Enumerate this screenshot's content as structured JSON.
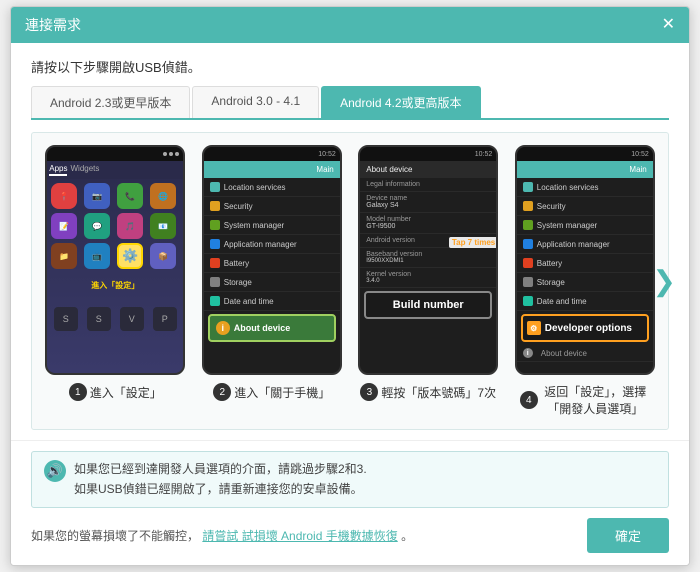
{
  "dialog": {
    "title": "連接需求",
    "close_label": "✕",
    "subtitle": "請按以下步驟開啟USB偵錯。"
  },
  "tabs": [
    {
      "label": "Android 2.3或更早版本",
      "active": false
    },
    {
      "label": "Android 3.0 - 4.1",
      "active": false
    },
    {
      "label": "Android 4.2或更高版本",
      "active": true
    }
  ],
  "steps": [
    {
      "num": "1",
      "caption": "進入「設定」",
      "screen": "settings"
    },
    {
      "num": "2",
      "caption": "進入「關于手機」",
      "screen": "about"
    },
    {
      "num": "3",
      "caption": "輕按「版本號碼」7次",
      "screen": "build",
      "tap_label": "Tap 7 times",
      "build_number": "Build number"
    },
    {
      "num": "4",
      "caption": "返回「設定」，選擇「開發人員選項」",
      "screen": "developer",
      "developer_options": "Developer options"
    }
  ],
  "nav_arrow": "❯",
  "notice": {
    "icon": "🔊",
    "line1": "如果您已經到達開發人員選項的介面，請跳過步驟2和3.",
    "line2": "如果USB偵錯已經開啟了，請重新連接您的安卓設備。"
  },
  "footer": {
    "text_prefix": "如果您的螢幕損壞了不能觸控，",
    "link_text": "請嘗試 試損壞 Android 手機數據恢復",
    "text_suffix": "。",
    "confirm_label": "確定"
  },
  "colors": {
    "accent": "#4db8b0",
    "highlight_yellow": "#ffe066",
    "highlight_orange": "#ffa020"
  },
  "menu_items": [
    "Location services",
    "Security",
    "System manager",
    "Application manager",
    "Battery",
    "Storage",
    "Date and time"
  ],
  "about_items": [
    {
      "label": "Legal information",
      "value": ""
    },
    {
      "label": "Device name",
      "value": "Galaxy S4"
    },
    {
      "label": "Model number",
      "value": "GT-I9500"
    },
    {
      "label": "Android version",
      "value": ""
    },
    {
      "label": "Baseband version",
      "value": ""
    },
    {
      "label": "Kernel version",
      "value": ""
    }
  ]
}
